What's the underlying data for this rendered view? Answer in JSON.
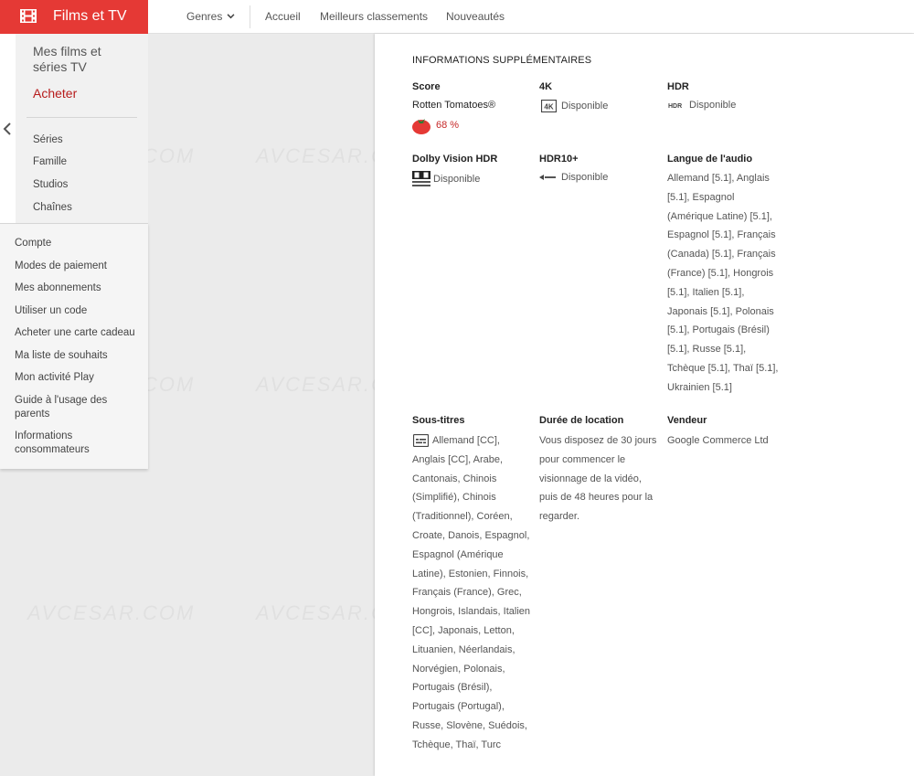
{
  "header": {
    "brand_title": "Films et TV",
    "nav": {
      "genres": "Genres",
      "home": "Accueil",
      "top_charts": "Meilleurs classements",
      "new": "Nouveautés"
    }
  },
  "sidebar": {
    "heading": "Mes films et séries TV",
    "buy": "Acheter",
    "categories": [
      "Séries",
      "Famille",
      "Studios",
      "Chaînes"
    ],
    "links": [
      "Compte",
      "Modes de paiement",
      "Mes abonnements",
      "Utiliser un code",
      "Acheter une carte cadeau",
      "Ma liste de souhaits",
      "Mon activité Play",
      "Guide à l'usage des parents",
      "Informations consommateurs"
    ]
  },
  "info": {
    "section_title": "INFORMATIONS SUPPLÉMENTAIRES",
    "score": {
      "label": "Score",
      "source": "Rotten Tomatoes®",
      "value": "68 %"
    },
    "uhd": {
      "label": "4K",
      "value": "Disponible"
    },
    "hdr": {
      "label": "HDR",
      "value": "Disponible"
    },
    "dolby": {
      "label": "Dolby Vision HDR",
      "value": "Disponible"
    },
    "hdr10": {
      "label": "HDR10+",
      "value": "Disponible"
    },
    "audio": {
      "label": "Langue de l'audio",
      "value": "Allemand [5.1], Anglais [5.1], Espagnol (Amérique Latine) [5.1], Espagnol [5.1], Français (Canada) [5.1], Français (France) [5.1], Hongrois [5.1], Italien [5.1], Japonais [5.1], Polonais [5.1], Portugais (Brésil) [5.1], Russe [5.1], Tchèque [5.1], Thaï [5.1], Ukrainien [5.1]"
    },
    "subtitles": {
      "label": "Sous-titres",
      "value": "Allemand [CC], Anglais [CC], Arabe, Cantonais, Chinois (Simplifié), Chinois (Traditionnel), Coréen, Croate, Danois, Espagnol, Espagnol (Amérique Latine), Estonien, Finnois, Français (France), Grec, Hongrois, Islandais, Italien [CC], Japonais, Letton, Lituanien, Néerlandais, Norvégien, Polonais, Portugais (Brésil), Portugais (Portugal), Russe, Slovène, Suédois, Tchèque, Thaï, Turc"
    },
    "rental": {
      "label": "Durée de location",
      "value": "Vous disposez de 30 jours pour commencer le visionnage de la vidéo, puis de 48 heures pour la regarder."
    },
    "seller": {
      "label": "Vendeur",
      "value": "Google Commerce Ltd"
    }
  },
  "watermark": "AVCESAR.COM",
  "colors": {
    "brand": "#e53935",
    "buy": "#b71c1c",
    "tomato": "#c62828"
  }
}
